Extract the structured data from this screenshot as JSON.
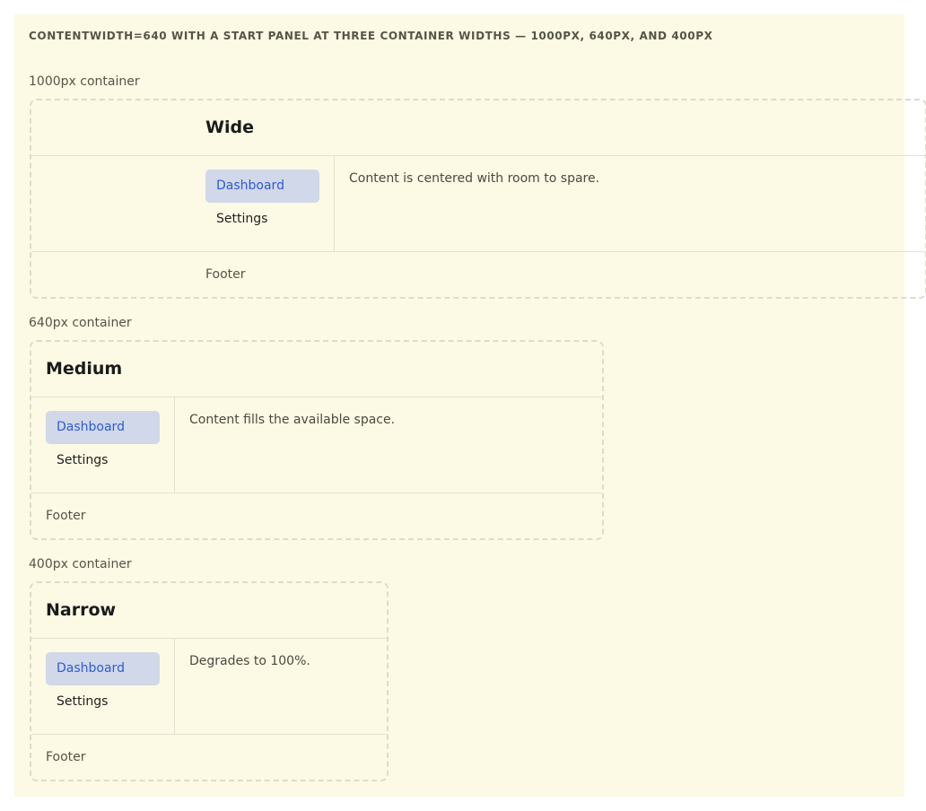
{
  "demo": {
    "title": "CONTENTWIDTH=640 WITH A START PANEL AT THREE CONTAINER WIDTHS — 1000PX, 640PX, AND 400PX"
  },
  "nav": {
    "dashboard_label": "Dashboard",
    "settings_label": "Settings",
    "active_item": "Dashboard"
  },
  "colors": {
    "page_background": "#fcf9e4",
    "active_nav_background": "#d0d8e9",
    "active_nav_text": "#2f5bd1"
  },
  "containers": [
    {
      "caption": "1000px container",
      "title": "Wide",
      "content": "Content is centered with room to spare.",
      "footer": "Footer"
    },
    {
      "caption": "640px container",
      "title": "Medium",
      "content": "Content fills the available space.",
      "footer": "Footer"
    },
    {
      "caption": "400px container",
      "title": "Narrow",
      "content": "Degrades to 100%.",
      "footer": "Footer"
    }
  ]
}
